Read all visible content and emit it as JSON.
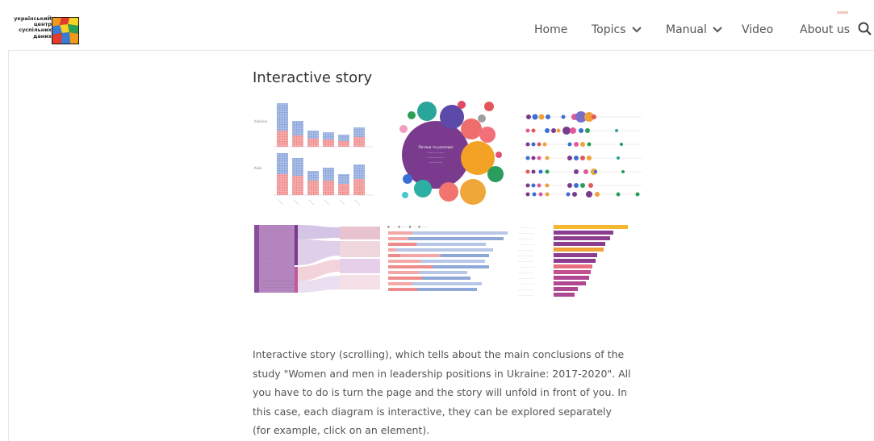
{
  "logo": {
    "lines": [
      "українськиЙ",
      "центр",
      "суспільних",
      "даних"
    ]
  },
  "nav": {
    "home": "Home",
    "topics": "Topics",
    "manual": "Manual",
    "video": "Video",
    "about": "About us"
  },
  "page": {
    "title": "Interactive story",
    "description": "Interactive story (scrolling), which tells about the main conclusions of the study \"Women and men in leadership positions in Ukraine: 2017-2020\". All you have to do is turn the page and the story will unfold in front of you. In this case, each diagram is interactive, they can be explored separately (for example, click on an element)."
  },
  "colors": {
    "accent_blue": "#8ea8d8",
    "accent_pink": "#ee8c8c",
    "purple": "#7b3f8c",
    "orange": "#f0a23a",
    "green": "#2daa5f"
  },
  "thumbnails": [
    {
      "name": "stacked-bar-thumbnail",
      "kind": "bar"
    },
    {
      "name": "bubble-thumbnail",
      "kind": "bubble"
    },
    {
      "name": "dot-plot-thumbnail",
      "kind": "dots"
    },
    {
      "name": "sankey-thumbnail",
      "kind": "sankey"
    },
    {
      "name": "horizontal-bar-thumbnail",
      "kind": "hbar"
    },
    {
      "name": "ranked-bar-thumbnail",
      "kind": "ranked"
    }
  ]
}
